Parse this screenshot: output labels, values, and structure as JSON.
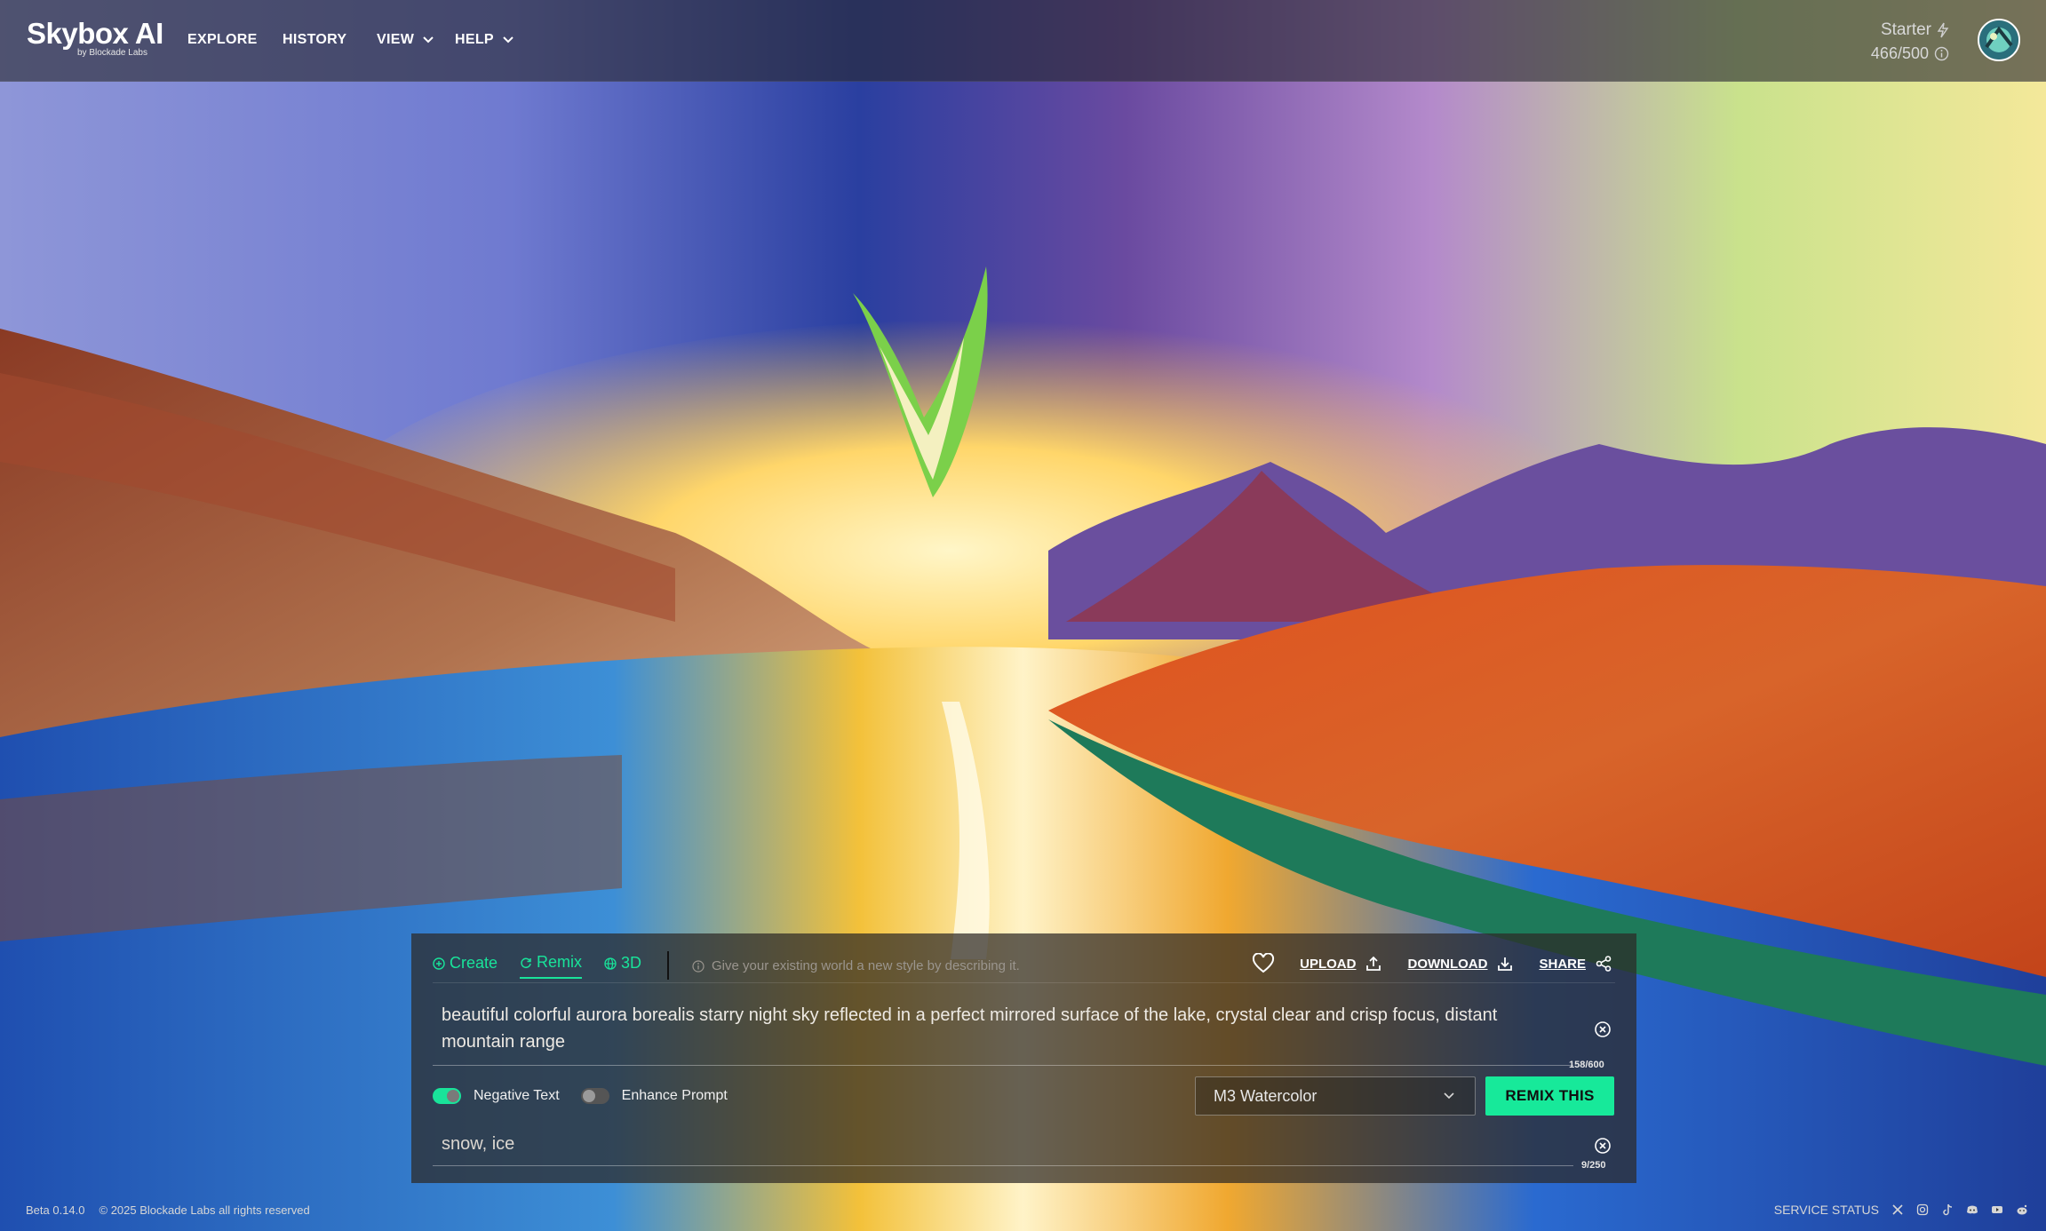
{
  "brand": {
    "title": "Skybox AI",
    "subtitle": "by Blockade Labs"
  },
  "nav": [
    {
      "label": "EXPLORE"
    },
    {
      "label": "HISTORY"
    },
    {
      "label": "VIEW"
    },
    {
      "label": "HELP"
    }
  ],
  "account": {
    "plan": "Starter",
    "credits": "466/500"
  },
  "panel": {
    "tabs": [
      {
        "label": "Create"
      },
      {
        "label": "Remix"
      },
      {
        "label": "3D"
      }
    ],
    "active_tab": "Remix",
    "hint": "Give your existing world a new style by describing it.",
    "actions": {
      "upload": "UPLOAD",
      "download": "DOWNLOAD",
      "share": "SHARE"
    },
    "prompt": "beautiful colorful aurora borealis starry night sky reflected in a perfect mirrored surface of the lake, crystal clear and crisp focus, distant mountain range",
    "prompt_counter": "158/600",
    "toggles": {
      "negative_text": {
        "label": "Negative Text",
        "on": true
      },
      "enhance_prompt": {
        "label": "Enhance Prompt",
        "on": false
      }
    },
    "style_select": "M3 Watercolor",
    "submit_label": "REMIX THIS",
    "negative_prompt": "snow, ice",
    "negative_counter": "9/250"
  },
  "footer": {
    "version": "Beta 0.14.0",
    "copyright": "© 2025 Blockade Labs all rights reserved",
    "service_status": "SERVICE STATUS",
    "social_icons": [
      "x-icon",
      "instagram-icon",
      "tiktok-icon",
      "discord-icon",
      "youtube-icon",
      "reddit-icon"
    ]
  },
  "colors": {
    "accent": "#19e39a",
    "button": "#17e99a"
  }
}
